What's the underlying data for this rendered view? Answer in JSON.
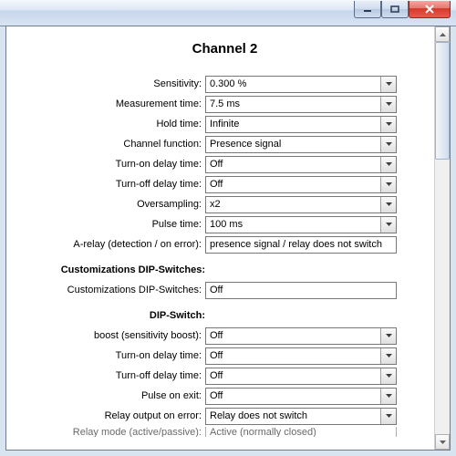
{
  "title": "Channel 2",
  "main": {
    "rows": [
      {
        "label": "Sensitivity:",
        "value": "0.300 %"
      },
      {
        "label": "Measurement time:",
        "value": "7.5 ms"
      },
      {
        "label": "Hold time:",
        "value": "Infinite"
      },
      {
        "label": "Channel function:",
        "value": "Presence signal"
      },
      {
        "label": "Turn-on delay time:",
        "value": "Off"
      },
      {
        "label": "Turn-off delay time:",
        "value": "Off"
      },
      {
        "label": "Oversampling:",
        "value": "x2"
      },
      {
        "label": "Pulse time:",
        "value": "100 ms"
      }
    ],
    "relay_label": "A-relay (detection / on error):",
    "relay_value": "presence signal / relay does not switch"
  },
  "cust": {
    "heading": "Customizations DIP-Switches:",
    "label": "Customizations DIP-Switches:",
    "value": "Off"
  },
  "dip": {
    "heading": "DIP-Switch:",
    "rows": [
      {
        "label": "boost (sensitivity boost):",
        "value": "Off"
      },
      {
        "label": "Turn-on delay time:",
        "value": "Off"
      },
      {
        "label": "Turn-off delay time:",
        "value": "Off"
      },
      {
        "label": "Pulse on exit:",
        "value": "Off"
      },
      {
        "label": "Relay output on error:",
        "value": "Relay does not switch"
      }
    ],
    "partial_label": "Relay mode (active/passive):",
    "partial_value": "Active (normally closed)"
  }
}
